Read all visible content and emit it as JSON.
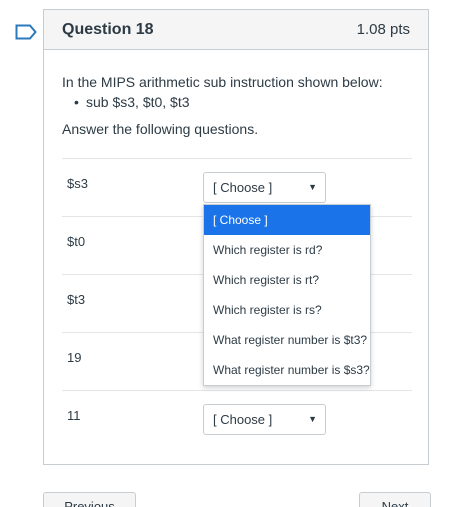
{
  "question": {
    "title": "Question 18",
    "points": "1.08 pts",
    "text": "In the MIPS arithmetic sub instruction shown below:",
    "bullet": "sub $s3, $t0, $t3",
    "instruction": "Answer the following questions."
  },
  "rows": [
    {
      "label": "$s3",
      "selected": "[ Choose ]"
    },
    {
      "label": "$t0",
      "selected": ""
    },
    {
      "label": "$t3",
      "selected": ""
    },
    {
      "label": "19",
      "selected": ""
    },
    {
      "label": "11",
      "selected": "[ Choose ]"
    }
  ],
  "dropdown": {
    "options": [
      "[ Choose ]",
      "Which register is rd?",
      "Which register is rt?",
      "Which register is rs?",
      "What register number is $t3?",
      "What register number is $s3?"
    ],
    "highlighted_index": 0
  },
  "navigation": {
    "previous_label": "Previous",
    "next_label": "Next"
  },
  "colors": {
    "highlight": "#1a73e8",
    "bookmark": "#2b7abc",
    "text": "#2d3b45",
    "border": "#c7cdd1"
  },
  "icons": {
    "bookmark": "bookmark-icon",
    "select_caret": "caret-down-icon",
    "bullet": "bullet-icon"
  }
}
